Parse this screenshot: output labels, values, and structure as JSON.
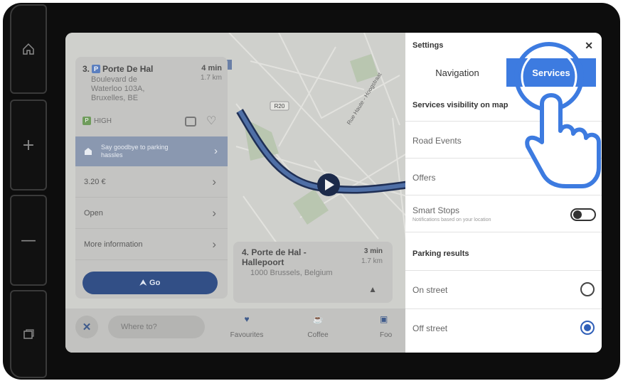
{
  "poi_card": {
    "number": "3.",
    "badge": "P",
    "name": "Porte De Hal",
    "time": "4 min",
    "distance": "1.7 km",
    "address": [
      "Boulevard de",
      "Waterloo 103A,",
      "Bruxelles, BE"
    ],
    "tag_badge": "P",
    "tag_label": "HIGH",
    "promo": "Say goodbye to parking hassles",
    "rows": [
      {
        "label": "3.20 €"
      },
      {
        "label": "Open"
      },
      {
        "label": "More information"
      }
    ],
    "go_label": "Go"
  },
  "poi_card_2": {
    "title": "4. Porte de Hal - Hallepoort",
    "address": "1000 Brussels, Belgium",
    "time": "3 min",
    "distance": "1.7 km"
  },
  "map": {
    "road_label_1": "R20",
    "road_label_2": "Rue Haute - Hoogstraat"
  },
  "bottom_bar": {
    "search_placeholder": "Where to?",
    "categories": [
      {
        "label": "Favourites",
        "icon": "heart-icon"
      },
      {
        "label": "Coffee",
        "icon": "coffee-icon"
      },
      {
        "label": "Foo",
        "icon": "food-icon"
      }
    ]
  },
  "settings": {
    "title": "Settings",
    "tabs": [
      {
        "label": "Navigation",
        "active": false
      },
      {
        "label": "Services",
        "active": true
      }
    ],
    "section_visibility": "Services visibility on map",
    "toggles": [
      {
        "label": "Road Events",
        "sub": "",
        "on": false
      },
      {
        "label": "Offers",
        "sub": "",
        "on": true
      },
      {
        "label": "Smart Stops",
        "sub": "Notifications based on your location",
        "on": false
      }
    ],
    "section_parking": "Parking results",
    "radios": [
      {
        "label": "On street",
        "selected": false
      },
      {
        "label": "Off street",
        "selected": true
      }
    ]
  },
  "colors": {
    "accent": "#3d7be0",
    "go_button": "#324f86",
    "route": "#2f5fb8",
    "frame": "#0d0d0d"
  }
}
